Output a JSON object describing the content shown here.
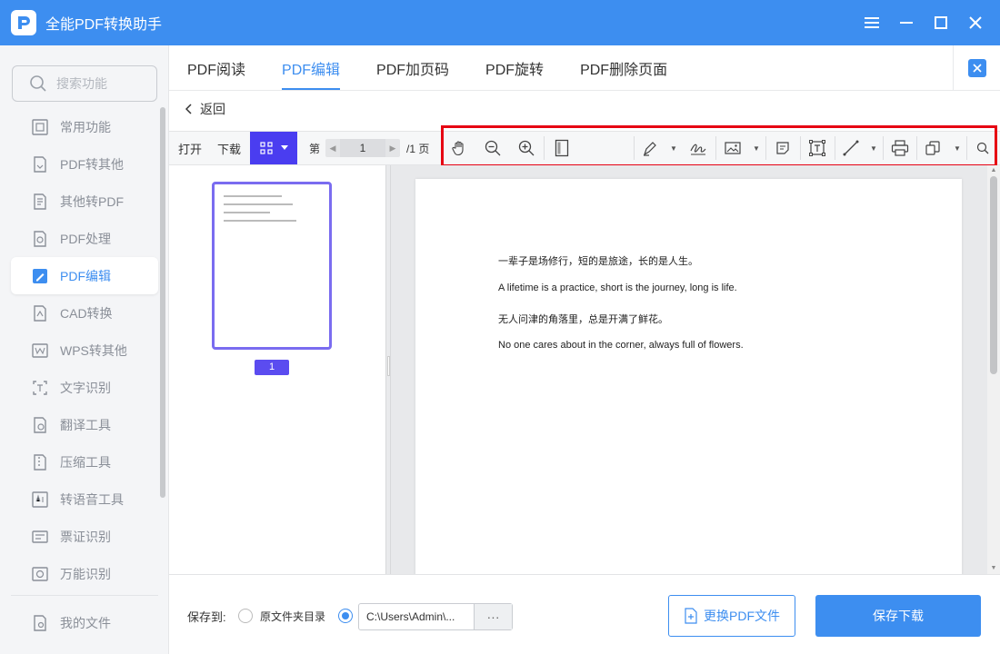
{
  "window": {
    "title": "全能PDF转换助手",
    "controls": [
      "menu-icon",
      "minimize-icon",
      "maximize-icon",
      "close-icon"
    ]
  },
  "sidebar": {
    "search_placeholder": "搜索功能",
    "items": [
      {
        "label": "常用功能",
        "icon": "common-functions-icon"
      },
      {
        "label": "PDF转其他",
        "icon": "pdf-to-other-icon"
      },
      {
        "label": "其他转PDF",
        "icon": "other-to-pdf-icon"
      },
      {
        "label": "PDF处理",
        "icon": "pdf-process-icon"
      },
      {
        "label": "PDF编辑",
        "icon": "pdf-edit-icon",
        "active": true
      },
      {
        "label": "CAD转换",
        "icon": "cad-convert-icon"
      },
      {
        "label": "WPS转其他",
        "icon": "wps-convert-icon"
      },
      {
        "label": "文字识别",
        "icon": "ocr-icon"
      },
      {
        "label": "翻译工具",
        "icon": "translate-icon"
      },
      {
        "label": "压缩工具",
        "icon": "compress-icon"
      },
      {
        "label": "转语音工具",
        "icon": "text-to-speech-icon"
      },
      {
        "label": "票证识别",
        "icon": "ticket-recognition-icon"
      },
      {
        "label": "万能识别",
        "icon": "universal-recognition-icon"
      }
    ],
    "bottom_item": {
      "label": "我的文件",
      "icon": "my-files-icon"
    }
  },
  "tabs": [
    {
      "label": "PDF阅读"
    },
    {
      "label": "PDF编辑",
      "active": true
    },
    {
      "label": "PDF加页码"
    },
    {
      "label": "PDF旋转"
    },
    {
      "label": "PDF删除页面"
    }
  ],
  "back_label": "返回",
  "toolbar": {
    "open_label": "打开",
    "download_label": "下载",
    "page_prefix": "第",
    "current_page": "1",
    "page_suffix": "/1 页",
    "tools": [
      "hand-icon",
      "zoom-out-icon",
      "zoom-in-icon",
      "fit-page-icon",
      "highlight-pen-icon",
      "signature-icon",
      "insert-image-icon",
      "note-icon",
      "text-box-icon",
      "line-icon",
      "print-icon",
      "copy-icon",
      "search-icon"
    ]
  },
  "thumbnail": {
    "page_number": "1"
  },
  "document": {
    "lines": [
      "一辈子是场修行，短的是旅途，长的是人生。",
      "A lifetime is a practice, short is the journey, long is life.",
      "无人问津的角落里，总是开满了鲜花。",
      "No one cares about in the corner, always full of flowers."
    ]
  },
  "bottom": {
    "save_to_label": "保存到:",
    "option_source_dir": "原文件夹目录",
    "custom_path": "C:\\Users\\Admin\\...",
    "path_more": "···",
    "replace_button": "更换PDF文件",
    "save_button": "保存下载"
  },
  "colors": {
    "accent": "#3d8ef0",
    "thumb_toggle": "#4a3df0",
    "highlight_box": "#e60012"
  }
}
